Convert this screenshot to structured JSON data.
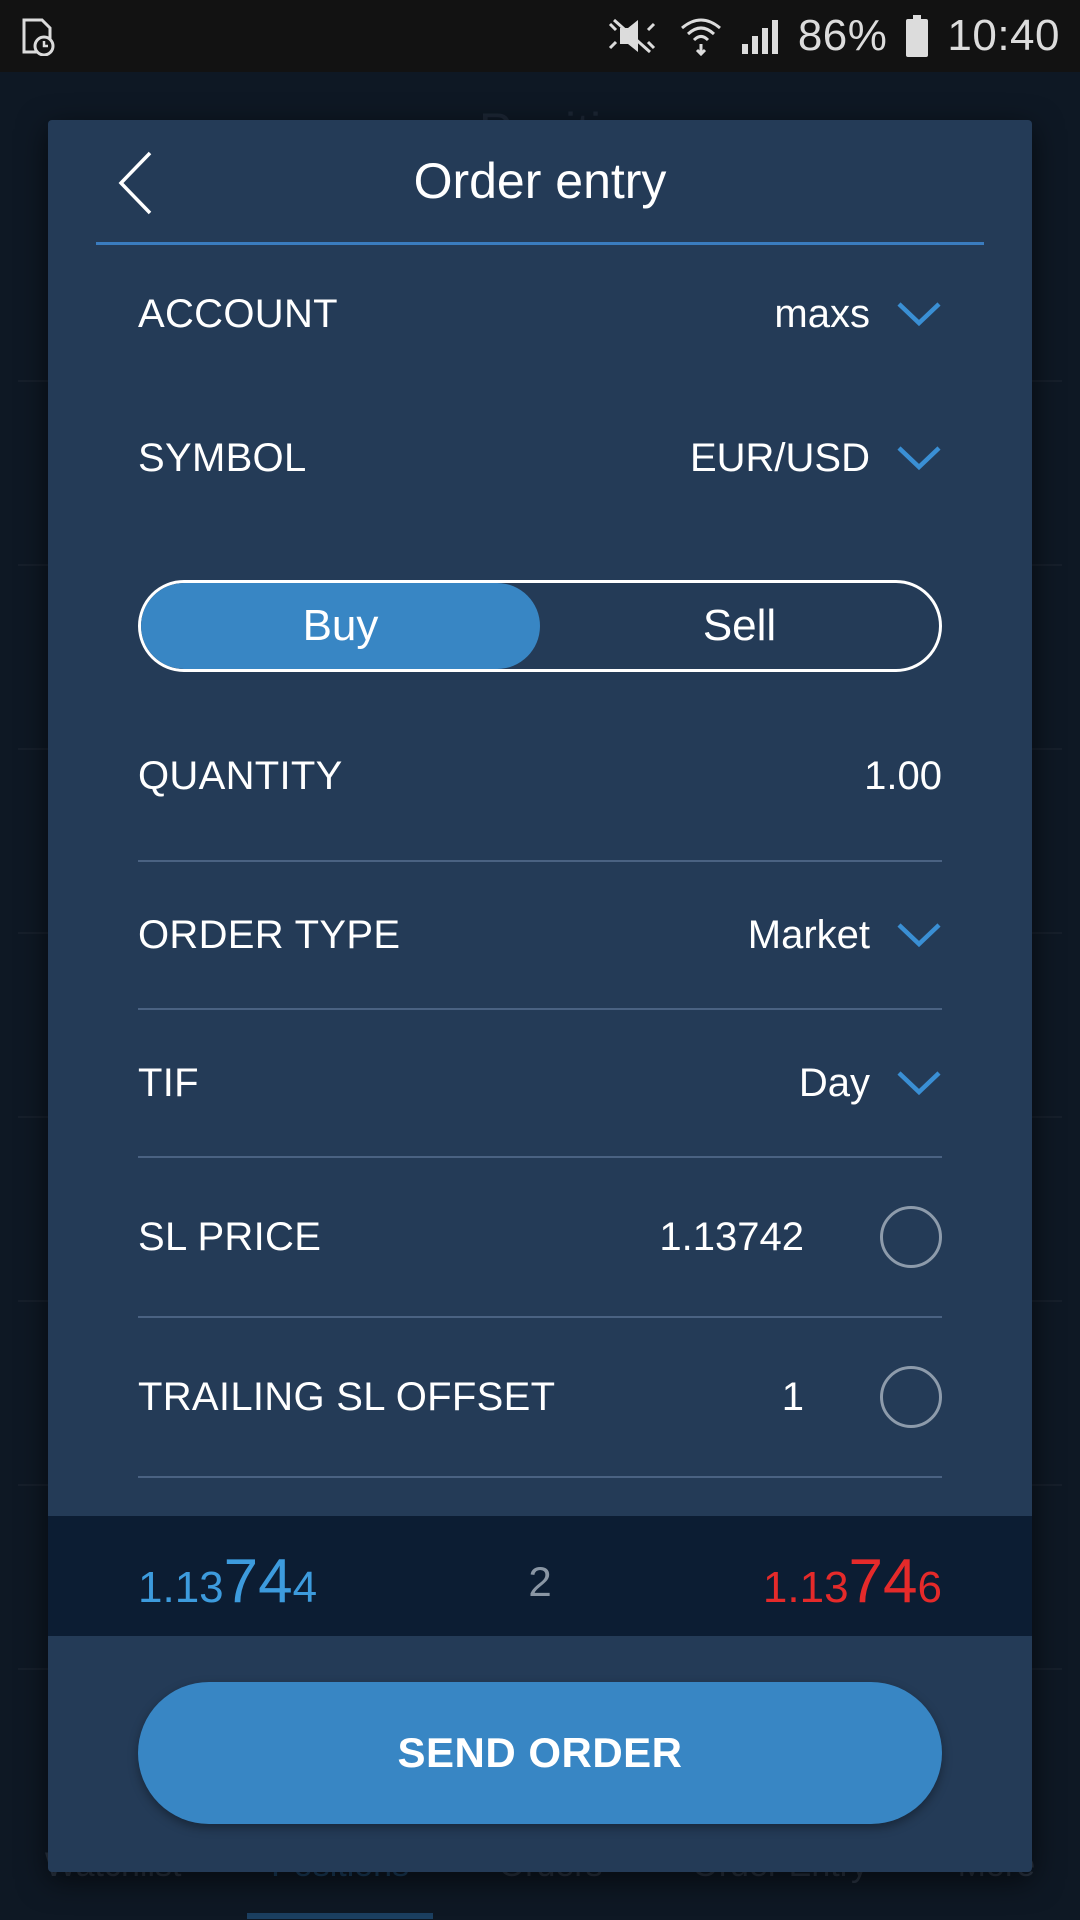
{
  "status_bar": {
    "battery": "86%",
    "time": "10:40",
    "icons": [
      "clock-sim-icon",
      "mute-icon",
      "wifi-icon",
      "signal-icon",
      "battery-icon"
    ]
  },
  "background": {
    "title": "Positi",
    "nav": {
      "items": [
        "Watchlist",
        "Positions",
        "Orders",
        "Order Entry",
        "More"
      ],
      "active": "Positions"
    }
  },
  "dialog": {
    "title": "Order entry",
    "back_icon": "chevron-left-icon",
    "account": {
      "label": "ACCOUNT",
      "value": "maxs"
    },
    "symbol": {
      "label": "SYMBOL",
      "value": "EUR/USD"
    },
    "side": {
      "buy": "Buy",
      "sell": "Sell",
      "selected": "Buy"
    },
    "quantity": {
      "label": "QUANTITY",
      "value": "1.00"
    },
    "order_type": {
      "label": "ORDER TYPE",
      "value": "Market"
    },
    "tif": {
      "label": "TIF",
      "value": "Day"
    },
    "sl_price": {
      "label": "SL PRICE",
      "value": "1.13742"
    },
    "trailing_sl": {
      "label": "TRAILING SL OFFSET",
      "value": "1"
    },
    "quote": {
      "bid_prefix": "1.13",
      "bid_big": "74",
      "bid_suffix": "4",
      "spread": "2",
      "ask_prefix": "1.13",
      "ask_big": "74",
      "ask_suffix": "6"
    },
    "send_label": "SEND ORDER"
  },
  "colors": {
    "accent": "#3886c4",
    "dialog_bg": "#243b57",
    "bid": "#3d9bdd",
    "ask": "#e52a2a",
    "quote_bar": "#0c1d33"
  }
}
